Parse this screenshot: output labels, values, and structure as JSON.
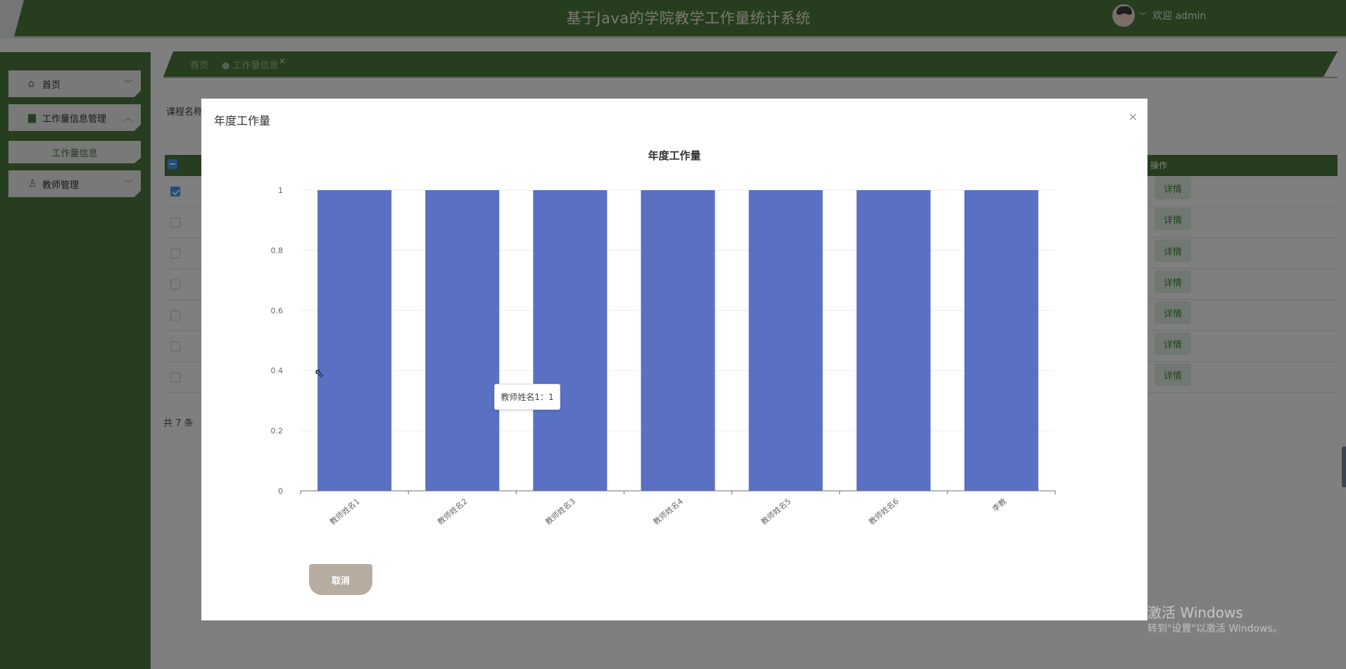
{
  "header": {
    "title": "基于Java的学院教学工作量统计系统",
    "welcome": "欢迎 admin"
  },
  "sidebar": {
    "items": [
      {
        "label": "首页"
      },
      {
        "label": "工作量信息管理"
      },
      {
        "label": "工作量信息"
      },
      {
        "label": "教师管理"
      }
    ]
  },
  "breadcrumb": {
    "home": "首页",
    "current": "工作量信息"
  },
  "search": {
    "label": "课程名称"
  },
  "table": {
    "op_header": "操作",
    "detail_label": "详情",
    "total": "共 7 条"
  },
  "modal": {
    "title": "年度工作量",
    "close": "×",
    "cancel_label": "取消",
    "tooltip": "教师姓名1：1"
  },
  "watermark": {
    "line1": "激活 Windows",
    "line2": "转到\"设置\"以激活 Windows。"
  },
  "colors": {
    "theme_green": "#4d7a3e",
    "bar": "#5a70c3",
    "cancel": "#b7aca0"
  },
  "chart_data": {
    "type": "bar",
    "title": "年度工作量",
    "categories": [
      "教师姓名1",
      "教师姓名2",
      "教师姓名3",
      "教师姓名4",
      "教师姓名5",
      "教师姓名6",
      "李教"
    ],
    "values": [
      1,
      1,
      1,
      1,
      1,
      1,
      1
    ],
    "ylim": [
      0,
      1
    ],
    "yticks": [
      0,
      0.2,
      0.4,
      0.6,
      0.8,
      1
    ],
    "ytick_labels": [
      "0",
      "0.2",
      "0.4",
      "0.6",
      "0.8",
      "1"
    ],
    "grid": true,
    "xlabel": "",
    "ylabel": ""
  }
}
